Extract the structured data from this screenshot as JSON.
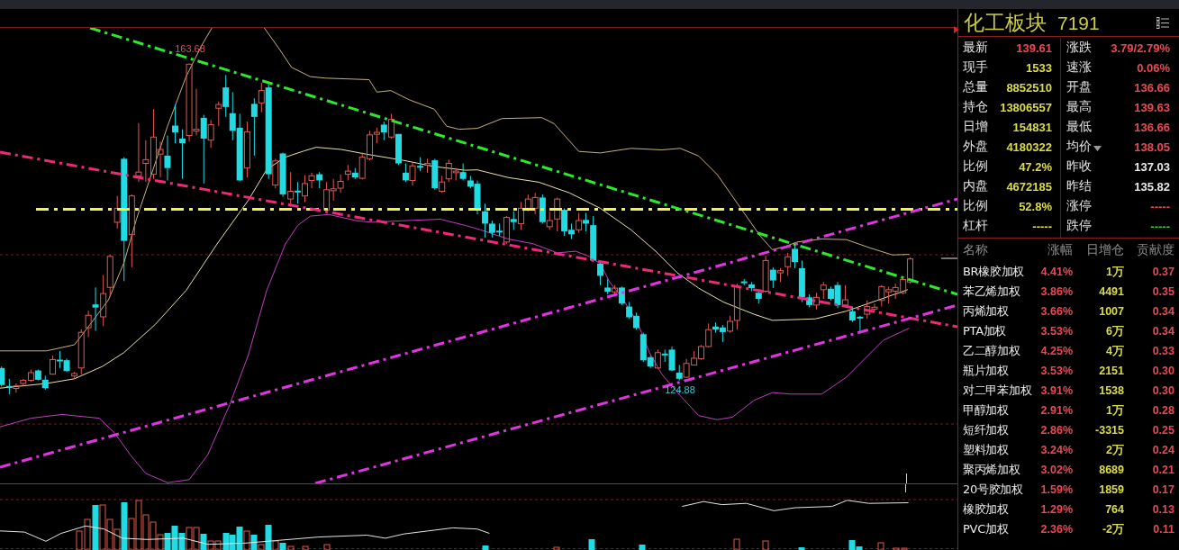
{
  "chart": {
    "high_label": "163.68",
    "low_label": "124.88"
  },
  "panel": {
    "title": "化工板块",
    "code": "7191"
  },
  "quote_rows": [
    {
      "left": {
        "label": "最新",
        "value": "139.61",
        "color": "#e84a52"
      },
      "right": {
        "label": "涨跌",
        "value": "3.79/2.79%",
        "color": "#e84a52",
        "dropdown": false
      }
    },
    {
      "left": {
        "label": "现手",
        "value": "1533",
        "color": "#dcdc46"
      },
      "right": {
        "label": "速涨",
        "value": "0.06%",
        "color": "#e84a52",
        "dropdown": false
      }
    },
    {
      "left": {
        "label": "总量",
        "value": "8852510",
        "color": "#dcdc46"
      },
      "right": {
        "label": "开盘",
        "value": "136.66",
        "color": "#e84a52",
        "dropdown": false
      }
    },
    {
      "left": {
        "label": "持仓",
        "value": "13806557",
        "color": "#dcdc46"
      },
      "right": {
        "label": "最高",
        "value": "139.63",
        "color": "#e84a52",
        "dropdown": false
      }
    },
    {
      "left": {
        "label": "日增",
        "value": "154831",
        "color": "#dcdc46"
      },
      "right": {
        "label": "最低",
        "value": "136.66",
        "color": "#e84a52",
        "dropdown": false
      }
    },
    {
      "left": {
        "label": "外盘",
        "value": "4180322",
        "color": "#dcdc46"
      },
      "right": {
        "label": "均价",
        "value": "138.05",
        "color": "#e84a52",
        "dropdown": true
      }
    },
    {
      "left": {
        "label": "比例",
        "value": "47.2%",
        "color": "#dcdc46"
      },
      "right": {
        "label": "昨收",
        "value": "137.03",
        "color": "#eaeaea",
        "dropdown": false
      }
    },
    {
      "left": {
        "label": "内盘",
        "value": "4672185",
        "color": "#dcdc46"
      },
      "right": {
        "label": "昨结",
        "value": "135.82",
        "color": "#eaeaea",
        "dropdown": false
      }
    },
    {
      "left": {
        "label": "比例",
        "value": "52.8%",
        "color": "#dcdc46"
      },
      "right": {
        "label": "涨停",
        "value": "-----",
        "color": "#e84a52",
        "dropdown": false
      }
    },
    {
      "left": {
        "label": "杠杆",
        "value": "-----",
        "color": "#dcdc46"
      },
      "right": {
        "label": "跌停",
        "value": "-----",
        "color": "#2ecc2e",
        "dropdown": false
      }
    }
  ],
  "table": {
    "columns": [
      "名称",
      "涨幅",
      "日增仓",
      "贡献度"
    ],
    "rows": [
      [
        "BR橡胶加权",
        "4.41%",
        "1万",
        "0.37"
      ],
      [
        "苯乙烯加权",
        "3.86%",
        "4491",
        "0.35"
      ],
      [
        "丙烯加权",
        "3.66%",
        "1007",
        "0.34"
      ],
      [
        "PTA加权",
        "3.53%",
        "6万",
        "0.34"
      ],
      [
        "乙二醇加权",
        "4.25%",
        "4万",
        "0.33"
      ],
      [
        "瓶片加权",
        "3.53%",
        "2151",
        "0.30"
      ],
      [
        "对二甲苯加权",
        "3.91%",
        "1538",
        "0.30"
      ],
      [
        "甲醇加权",
        "2.91%",
        "1万",
        "0.28"
      ],
      [
        "短纤加权",
        "2.86%",
        "-3315",
        "0.25"
      ],
      [
        "塑料加权",
        "3.24%",
        "2万",
        "0.24"
      ],
      [
        "聚丙烯加权",
        "3.02%",
        "8689",
        "0.21"
      ],
      [
        "20号胶加权",
        "1.59%",
        "1859",
        "0.17"
      ],
      [
        "橡胶加权",
        "1.29%",
        "764",
        "0.13"
      ],
      [
        "PVC加权",
        "2.36%",
        "-2万",
        "0.11"
      ]
    ]
  }
}
